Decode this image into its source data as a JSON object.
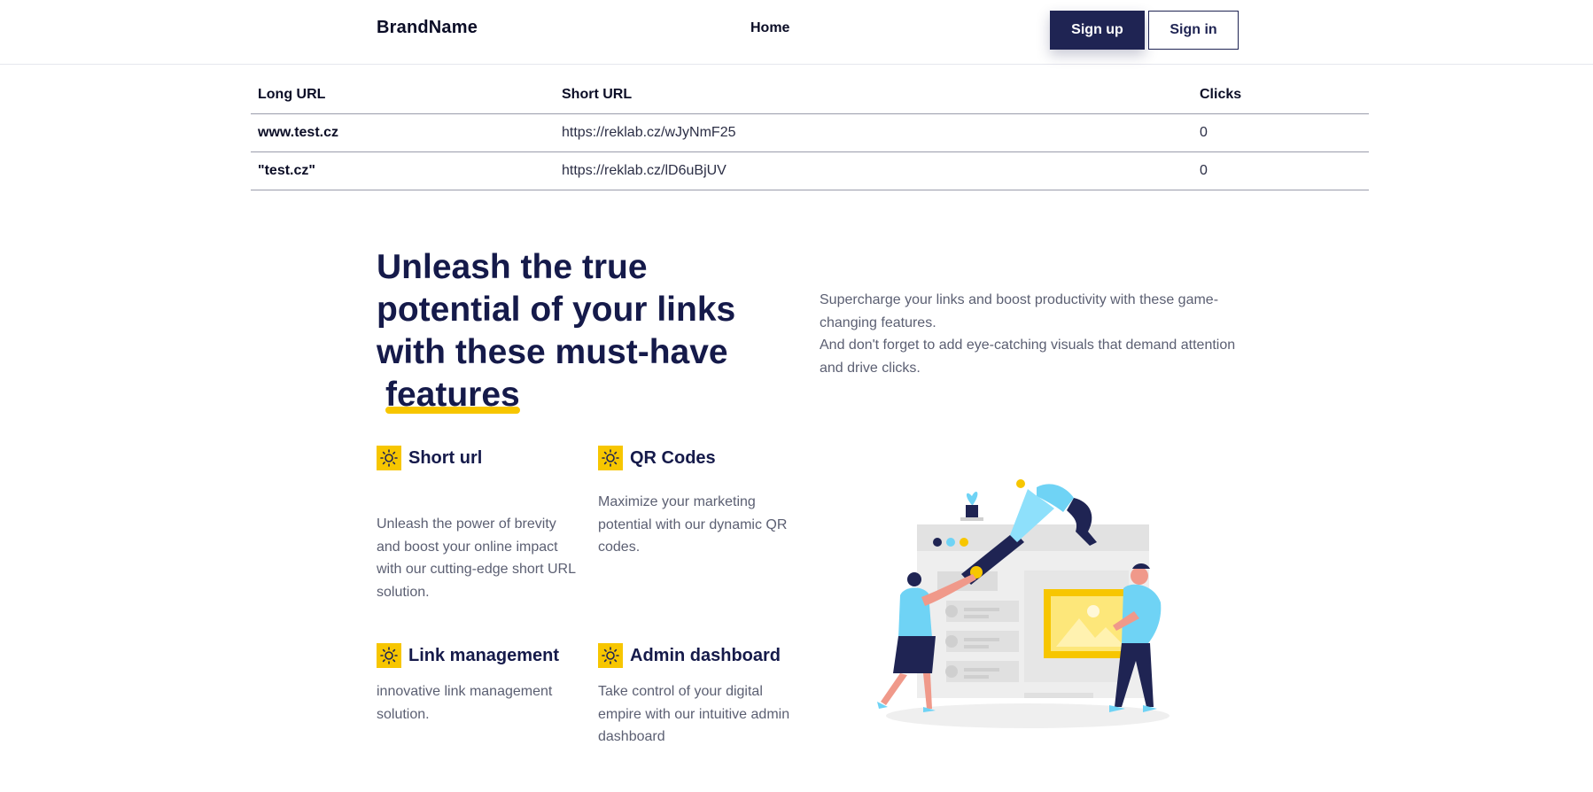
{
  "header": {
    "brand": "BrandName",
    "nav_home": "Home",
    "signup_label": "Sign up",
    "signin_label": "Sign in"
  },
  "table": {
    "columns": [
      "Long URL",
      "Short URL",
      "Clicks"
    ],
    "rows": [
      {
        "long": "www.test.cz",
        "short": "https://reklab.cz/wJyNmF25",
        "clicks": "0"
      },
      {
        "long": "\"test.cz\"",
        "short": "https://reklab.cz/lD6uBjUV",
        "clicks": "0"
      }
    ]
  },
  "hero": {
    "title_main": "Unleash the true potential of your links with these must-have",
    "title_highlight": "features",
    "desc_line1": "Supercharge your links and boost productivity with these game-changing features.",
    "desc_line2": "And don't forget to add eye-catching visuals that demand attention and drive clicks."
  },
  "features": [
    {
      "icon": "sun-icon",
      "title": "Short url",
      "desc": "Unleash the power of brevity and boost your online impact with our cutting-edge short URL solution."
    },
    {
      "icon": "sun-icon",
      "title": "QR Codes",
      "desc": "Maximize your marketing potential with our dynamic QR codes."
    },
    {
      "icon": "sun-icon",
      "title": "Link management",
      "desc": "innovative link management solution."
    },
    {
      "icon": "sun-icon",
      "title": "Admin dashboard",
      "desc": "Take control of your digital empire with our intuitive admin dashboard"
    }
  ],
  "colors": {
    "primary": "#1f2453",
    "accent": "#f7c600",
    "text_dark": "#151a4a",
    "text_muted": "#5b5f72",
    "illustration_blue": "#6fd3f5"
  }
}
